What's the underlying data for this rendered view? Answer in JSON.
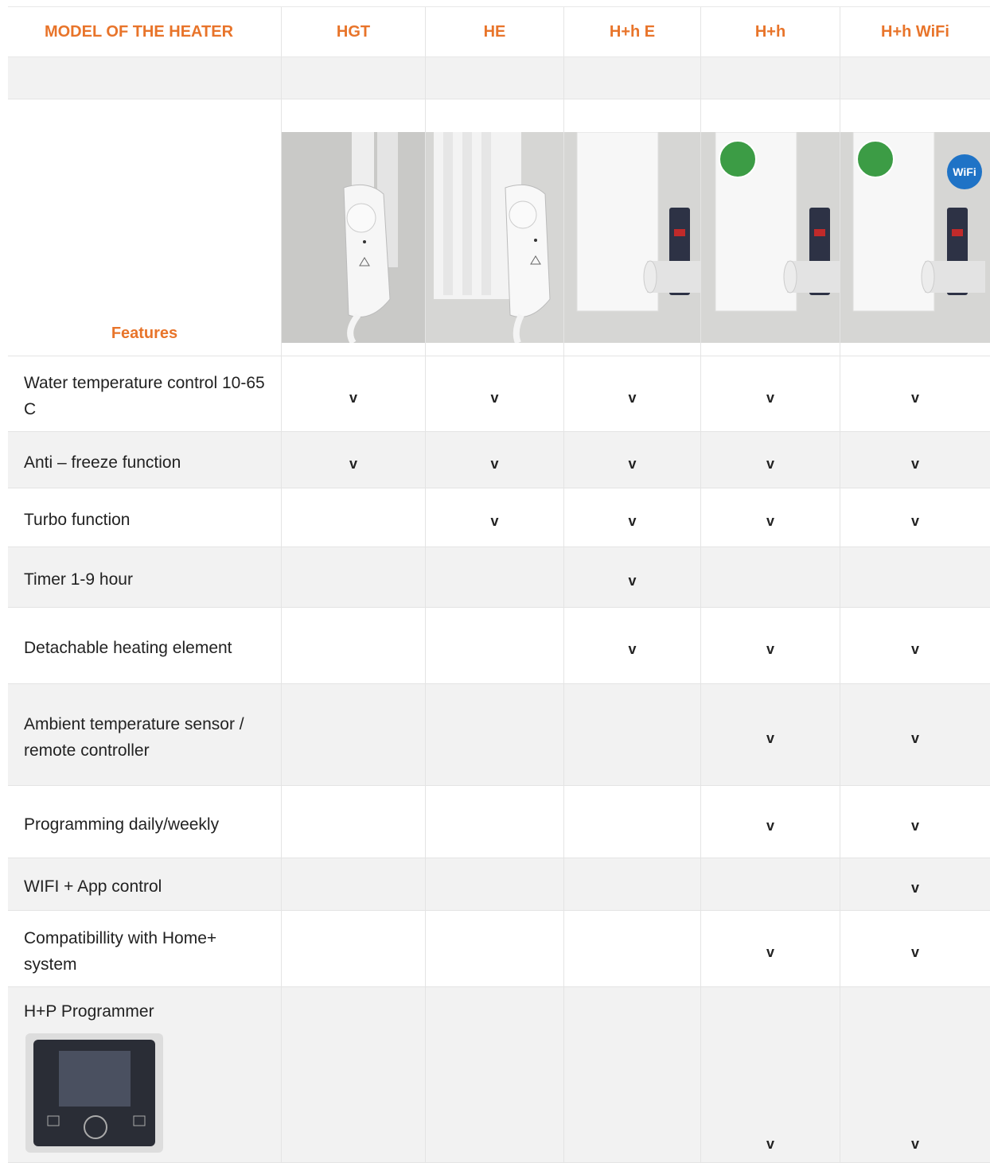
{
  "header": {
    "model_label": "MODEL OF THE HEATER",
    "models": [
      "HGT",
      "HE",
      "H+h E",
      "H+h",
      "H+h WiFi"
    ]
  },
  "features_label": "Features",
  "rows": [
    {
      "label": "Water temperature control 10-65 C",
      "checks": [
        "v",
        "v",
        "v",
        "v",
        "v"
      ]
    },
    {
      "label": "Anti – freeze function",
      "checks": [
        "v",
        "v",
        "v",
        "v",
        "v"
      ]
    },
    {
      "label": "Turbo function",
      "checks": [
        "",
        "v",
        "v",
        "v",
        "v"
      ]
    },
    {
      "label": "Timer 1-9 hour",
      "checks": [
        "",
        "",
        "v",
        "",
        ""
      ]
    },
    {
      "label": "Detachable heating element",
      "checks": [
        "",
        "",
        "v",
        "v",
        "v"
      ]
    },
    {
      "label": "Ambient temperature sensor / remote controller",
      "checks": [
        "",
        "",
        "",
        "v",
        "v"
      ]
    },
    {
      "label": "Programming daily/weekly",
      "checks": [
        "",
        "",
        "",
        "v",
        "v"
      ]
    },
    {
      "label": "WIFI + App control",
      "checks": [
        "",
        "",
        "",
        "",
        "v"
      ]
    },
    {
      "label": "Compatibillity with Home+ system",
      "checks": [
        "",
        "",
        "",
        "v",
        "v"
      ]
    },
    {
      "label": "H+P Programmer",
      "checks": [
        "",
        "",
        "",
        "v",
        "v"
      ]
    }
  ],
  "colors": {
    "accent": "#e8742a",
    "shade": "#f2f2f2",
    "eco_green": "#3c9c45",
    "wifi_blue": "#1f73c6"
  },
  "badges": {
    "wifi_text": "WiFi"
  }
}
